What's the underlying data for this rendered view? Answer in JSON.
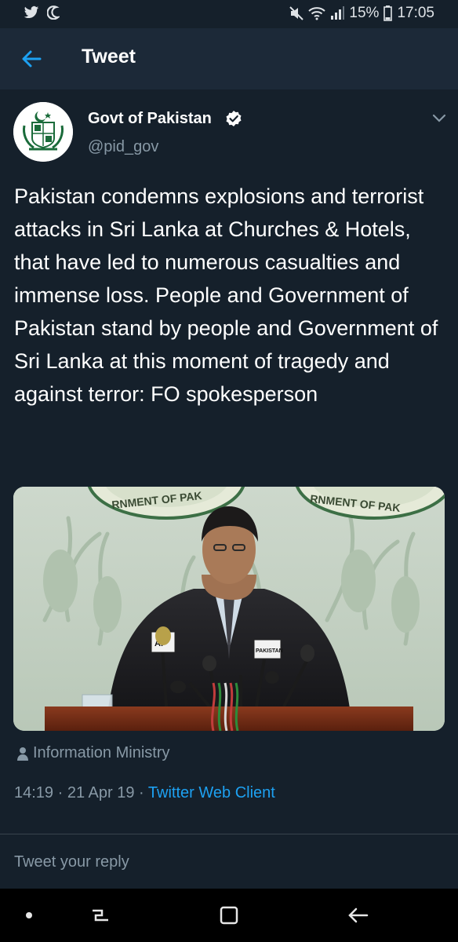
{
  "status_bar": {
    "battery": "15%",
    "time": "17:05",
    "icons": [
      "twitter-icon",
      "moon-icon",
      "mute-icon",
      "wifi-icon",
      "signal-icon",
      "battery-icon"
    ]
  },
  "header": {
    "title": "Tweet",
    "back_icon": "back-arrow-icon"
  },
  "tweet": {
    "author_name": "Govt of Pakistan",
    "handle": "@pid_gov",
    "verified": true,
    "text": "Pakistan condemns explosions and terrorist attacks in Sri Lanka at Churches & Hotels, that have led to numerous casualties and immense loss. People and Government of Pakistan stand by people and Government of Sri Lanka at this moment of tragedy and against terror: FO spokesperson",
    "image": {
      "seal_text_left": "RNMENT OF PAK",
      "seal_text_right": "RNMENT OF PAK",
      "mic_label_1": "AP",
      "mic_label_2": "PAKISTAN"
    },
    "location": "Information Ministry",
    "time": "14:19",
    "date": "21 Apr 19",
    "client": "Twitter Web Client",
    "separator": "·"
  },
  "reply": {
    "placeholder": "Tweet your reply"
  },
  "colors": {
    "background": "#15202b",
    "header": "#1c2938",
    "accent": "#1da1f2",
    "muted": "#8899a6"
  }
}
